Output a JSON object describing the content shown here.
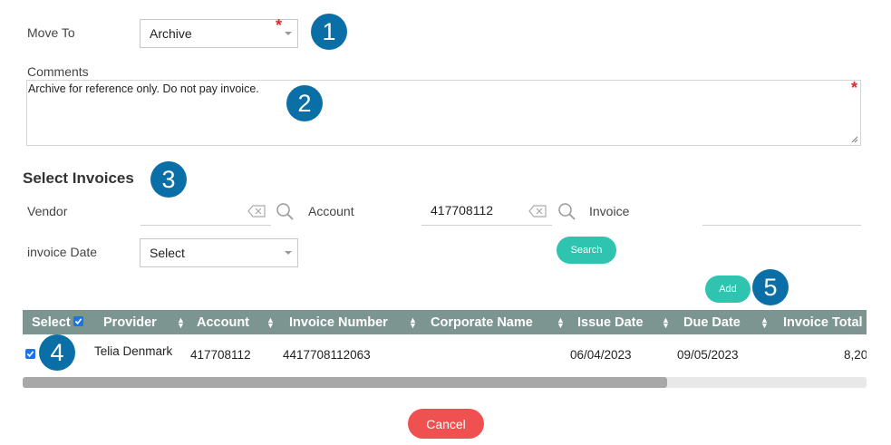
{
  "move_to": {
    "label": "Move To",
    "value": "Archive"
  },
  "comments": {
    "label": "Comments",
    "value": "Archive for reference only. Do not pay invoice."
  },
  "select_invoices": {
    "title": "Select Invoices",
    "vendor_label": "Vendor",
    "vendor_value": "",
    "account_label": "Account",
    "account_value": "417708112",
    "invoice_label": "Invoice",
    "invoice_value": "",
    "date_label": "invoice Date",
    "date_value": "Select",
    "search_button": "Search",
    "add_button": "Add"
  },
  "table": {
    "columns": [
      "Select",
      "Provider",
      "Account",
      "Invoice Number",
      "Corporate Name",
      "Issue Date",
      "Due Date",
      "Invoice Total"
    ],
    "rows": [
      {
        "provider": "Telia Denmark",
        "account": "417708112",
        "invoice_number": "4417708112063",
        "corporate_name": "",
        "issue_date": "06/04/2023",
        "due_date": "09/05/2023",
        "invoice_total": "8,20"
      }
    ]
  },
  "cancel_button": "Cancel",
  "badges": [
    "1",
    "2",
    "3",
    "4",
    "5"
  ],
  "colors": {
    "badge": "#0a6fa6",
    "accent": "#2ec4b0",
    "cancel": "#ef5050",
    "header": "#7d9591",
    "required": "#e0282e"
  }
}
